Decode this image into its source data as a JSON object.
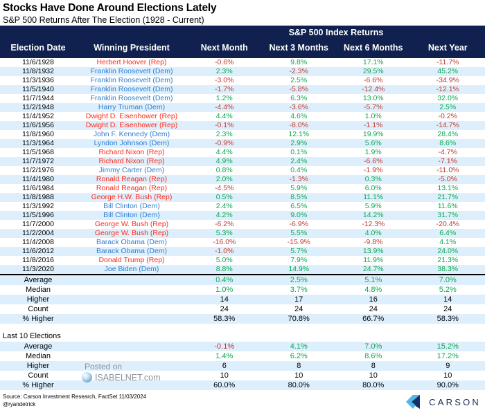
{
  "header": {
    "main_title": "Stocks Have Done Around Elections Lately",
    "sub_title": "S&P 500 Returns After The Election (1928 - Current)",
    "group_header": "S&P 500 Index Returns",
    "columns": [
      "Election Date",
      "Winning President",
      "Next Month",
      "Next 3 Months",
      "Next 6 Months",
      "Next Year"
    ]
  },
  "rows": [
    {
      "date": "11/6/1928",
      "president": "Herbert Hoover (Rep)",
      "party": "Rep",
      "m1": "-0.6%",
      "m3": "9.8%",
      "m6": "17.1%",
      "y1": "-11.7%"
    },
    {
      "date": "11/8/1932",
      "president": "Franklin Roosevelt (Dem)",
      "party": "Dem",
      "m1": "2.3%",
      "m3": "-2.3%",
      "m6": "29.5%",
      "y1": "45.2%"
    },
    {
      "date": "11/3/1936",
      "president": "Franklin Roosevelt (Dem)",
      "party": "Dem",
      "m1": "-3.0%",
      "m3": "2.5%",
      "m6": "-6.6%",
      "y1": "-34.9%"
    },
    {
      "date": "11/5/1940",
      "president": "Franklin Roosevelt (Dem)",
      "party": "Dem",
      "m1": "-1.7%",
      "m3": "-5.8%",
      "m6": "-12.4%",
      "y1": "-12.1%"
    },
    {
      "date": "11/7/1944",
      "president": "Franklin Roosevelt (Dem)",
      "party": "Dem",
      "m1": "1.2%",
      "m3": "6.3%",
      "m6": "13.0%",
      "y1": "32.0%"
    },
    {
      "date": "11/2/1948",
      "president": "Harry Truman (Dem)",
      "party": "Dem",
      "m1": "-4.4%",
      "m3": "-3.6%",
      "m6": "-5.7%",
      "y1": "2.5%"
    },
    {
      "date": "11/4/1952",
      "president": "Dwight D. Eisenhower (Rep)",
      "party": "Rep",
      "m1": "4.4%",
      "m3": "4.6%",
      "m6": "1.0%",
      "y1": "-0.2%"
    },
    {
      "date": "11/6/1956",
      "president": "Dwight D. Eisenhower (Rep)",
      "party": "Rep",
      "m1": "-0.1%",
      "m3": "-8.0%",
      "m6": "-1.1%",
      "y1": "-14.7%"
    },
    {
      "date": "11/8/1960",
      "president": "John F. Kennedy (Dem)",
      "party": "Dem",
      "m1": "2.3%",
      "m3": "12.1%",
      "m6": "19.9%",
      "y1": "28.4%"
    },
    {
      "date": "11/3/1964",
      "president": "Lyndon Johnson (Dem)",
      "party": "Dem",
      "m1": "-0.9%",
      "m3": "2.9%",
      "m6": "5.6%",
      "y1": "8.6%"
    },
    {
      "date": "11/5/1968",
      "president": "Richard Nixon (Rep)",
      "party": "Rep",
      "m1": "4.4%",
      "m3": "0.1%",
      "m6": "1.9%",
      "y1": "-4.7%"
    },
    {
      "date": "11/7/1972",
      "president": "Richard Nixon (Rep)",
      "party": "Rep",
      "m1": "4.9%",
      "m3": "2.4%",
      "m6": "-6.6%",
      "y1": "-7.1%"
    },
    {
      "date": "11/2/1976",
      "president": "Jimmy Carter (Dem)",
      "party": "Dem",
      "m1": "0.8%",
      "m3": "0.4%",
      "m6": "-1.9%",
      "y1": "-11.0%"
    },
    {
      "date": "11/4/1980",
      "president": "Ronald Reagan (Rep)",
      "party": "Rep",
      "m1": "2.0%",
      "m3": "-1.3%",
      "m6": "0.3%",
      "y1": "-5.0%"
    },
    {
      "date": "11/6/1984",
      "president": "Ronald Reagan (Rep)",
      "party": "Rep",
      "m1": "-4.5%",
      "m3": "5.9%",
      "m6": "6.0%",
      "y1": "13.1%"
    },
    {
      "date": "11/8/1988",
      "president": "George H.W. Bush (Rep)",
      "party": "Rep",
      "m1": "0.5%",
      "m3": "8.5%",
      "m6": "11.1%",
      "y1": "21.7%"
    },
    {
      "date": "11/3/1992",
      "president": "Bill Clinton (Dem)",
      "party": "Dem",
      "m1": "2.4%",
      "m3": "6.5%",
      "m6": "5.9%",
      "y1": "11.6%"
    },
    {
      "date": "11/5/1996",
      "president": "Bill Clinton (Dem)",
      "party": "Dem",
      "m1": "4.2%",
      "m3": "9.0%",
      "m6": "14.2%",
      "y1": "31.7%"
    },
    {
      "date": "11/7/2000",
      "president": "George W. Bush (Rep)",
      "party": "Rep",
      "m1": "-6.2%",
      "m3": "-6.9%",
      "m6": "-12.3%",
      "y1": "-20.4%"
    },
    {
      "date": "11/2/2004",
      "president": "George W. Bush (Rep)",
      "party": "Rep",
      "m1": "5.3%",
      "m3": "5.5%",
      "m6": "4.0%",
      "y1": "6.4%"
    },
    {
      "date": "11/4/2008",
      "president": "Barack Obama (Dem)",
      "party": "Dem",
      "m1": "-16.0%",
      "m3": "-15.9%",
      "m6": "-9.8%",
      "y1": "4.1%"
    },
    {
      "date": "11/6/2012",
      "president": "Barack Obama (Dem)",
      "party": "Dem",
      "m1": "-1.0%",
      "m3": "5.7%",
      "m6": "13.9%",
      "y1": "24.0%"
    },
    {
      "date": "11/8/2016",
      "president": "Donald Trump (Rep)",
      "party": "Rep",
      "m1": "5.0%",
      "m3": "7.9%",
      "m6": "11.9%",
      "y1": "21.3%"
    },
    {
      "date": "11/3/2020",
      "president": "Joe Biden (Dem)",
      "party": "Dem",
      "m1": "8.8%",
      "m3": "14.9%",
      "m6": "24.7%",
      "y1": "38.3%"
    }
  ],
  "summary_all": [
    {
      "label": "Average",
      "kind": "pct",
      "m1": "0.4%",
      "m3": "2.5%",
      "m6": "5.1%",
      "y1": "7.0%"
    },
    {
      "label": "Median",
      "kind": "pct",
      "m1": "1.0%",
      "m3": "3.7%",
      "m6": "4.8%",
      "y1": "5.2%"
    },
    {
      "label": "Higher",
      "kind": "count",
      "m1": "14",
      "m3": "17",
      "m6": "16",
      "y1": "14"
    },
    {
      "label": "Count",
      "kind": "count",
      "m1": "24",
      "m3": "24",
      "m6": "24",
      "y1": "24"
    },
    {
      "label": "% Higher",
      "kind": "count",
      "m1": "58.3%",
      "m3": "70.8%",
      "m6": "66.7%",
      "y1": "58.3%"
    }
  ],
  "last10_title": "Last 10 Elections",
  "summary_last10": [
    {
      "label": "Average",
      "kind": "pct",
      "m1": "-0.1%",
      "m3": "4.1%",
      "m6": "7.0%",
      "y1": "15.2%"
    },
    {
      "label": "Median",
      "kind": "pct",
      "m1": "1.4%",
      "m3": "6.2%",
      "m6": "8.6%",
      "y1": "17.2%"
    },
    {
      "label": "Higher",
      "kind": "count",
      "m1": "6",
      "m3": "8",
      "m6": "8",
      "y1": "9"
    },
    {
      "label": "Count",
      "kind": "count",
      "m1": "10",
      "m3": "10",
      "m6": "10",
      "y1": "10"
    },
    {
      "label": "% Higher",
      "kind": "count",
      "m1": "60.0%",
      "m3": "80.0%",
      "m6": "80.0%",
      "y1": "90.0%"
    }
  ],
  "watermark": {
    "posted_on": "Posted on",
    "site": "ISABELNET.com"
  },
  "footer": {
    "source": "Source: Carson Investment Research, FactSet 11/03/2024",
    "handle": "@ryandetrick",
    "brand": "CARSON"
  },
  "colors": {
    "header_bg": "#10214f",
    "row_alt": "#ddeffc",
    "positive": "#0aa84f",
    "negative": "#c0392b",
    "rep": "#ff2a18",
    "dem": "#2f7fd0",
    "logo_light": "#4fb9e8",
    "logo_dark": "#15306b"
  }
}
